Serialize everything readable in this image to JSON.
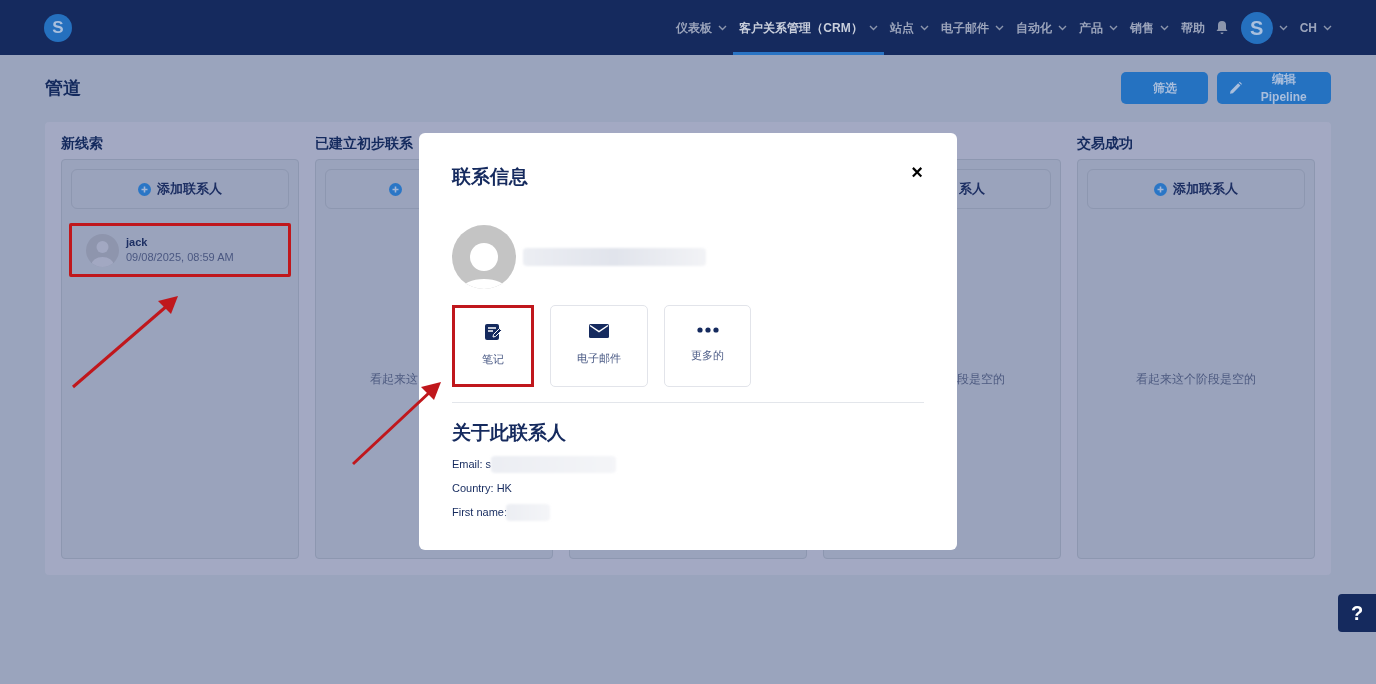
{
  "logo": {
    "letter": "S"
  },
  "nav": [
    {
      "label": "仪表板",
      "selected": false,
      "dropdown": true
    },
    {
      "label": "客户关系管理（CRM）",
      "selected": true,
      "dropdown": true
    },
    {
      "label": "站点",
      "selected": false,
      "dropdown": true
    },
    {
      "label": "电子邮件",
      "selected": false,
      "dropdown": true
    },
    {
      "label": "自动化",
      "selected": false,
      "dropdown": true
    },
    {
      "label": "产品",
      "selected": false,
      "dropdown": true
    },
    {
      "label": "销售",
      "selected": false,
      "dropdown": true
    },
    {
      "label": "帮助",
      "selected": false,
      "dropdown": false
    }
  ],
  "user": {
    "initial": "S",
    "language": "CH"
  },
  "page_title": "管道",
  "actions": [
    {
      "label": "筛选",
      "kind": "plain"
    },
    {
      "label": "编辑 Pipeline",
      "kind": "edit"
    }
  ],
  "columns": [
    {
      "title": "新线索",
      "add_label": "添加联系人",
      "kind": "full",
      "cards": [
        {
          "name": "jack",
          "time": "09/08/2025, 08:59 AM",
          "highlighted": true
        }
      ]
    },
    {
      "title": "已建立初步联系",
      "empty_text": "看起来这",
      "kind": "leftpart"
    },
    {
      "kind": "hidden"
    },
    {
      "add_label": "系人",
      "empty_text": "段是空的",
      "kind": "rightpart"
    },
    {
      "title": "交易成功",
      "add_label": "添加联系人",
      "empty_text": "看起来这个阶段是空的",
      "kind": "full"
    }
  ],
  "modal": {
    "title": "联系信息",
    "close": "×",
    "actions": [
      {
        "label": "笔记",
        "kind": "note",
        "highlighted": true
      },
      {
        "label": "电子邮件",
        "kind": "mail",
        "highlighted": false
      },
      {
        "label": "更多的",
        "kind": "more",
        "highlighted": false
      }
    ],
    "about_title": "关于此联系人",
    "fields": [
      {
        "text": "Email: s",
        "redacted": true
      },
      {
        "text": "Country: HK",
        "redacted": false
      },
      {
        "text": "First name:",
        "redacted": true
      }
    ]
  },
  "help": "?"
}
